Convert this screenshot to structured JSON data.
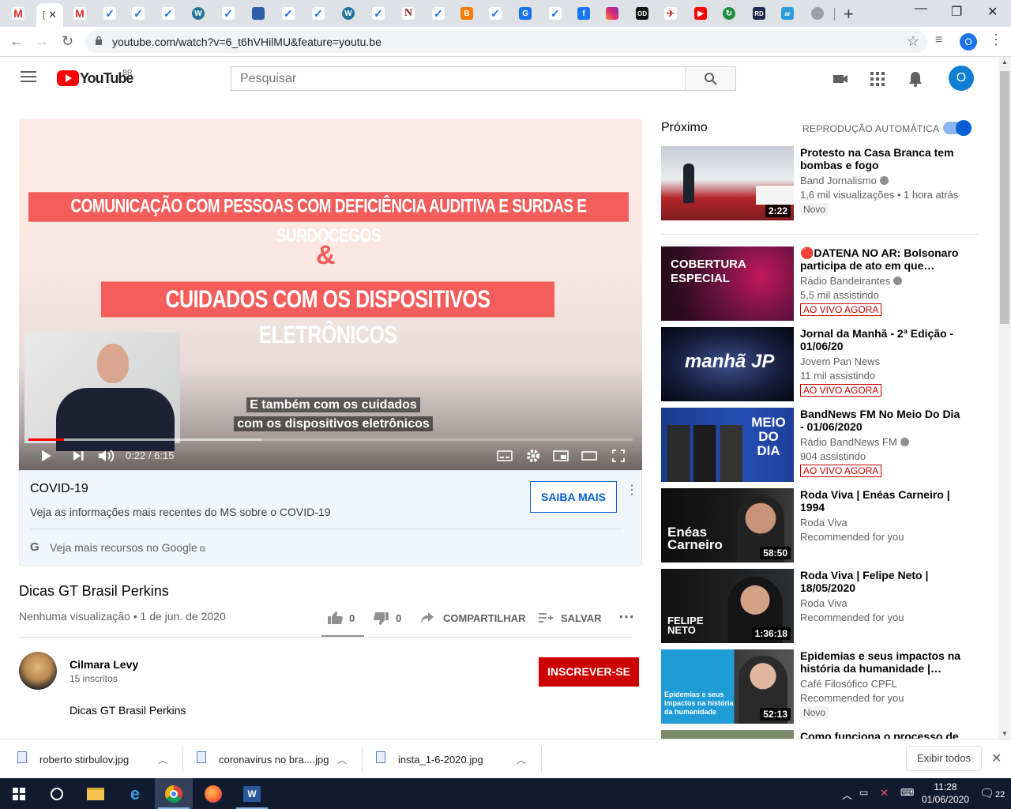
{
  "browser": {
    "active_tab_glyph": "[",
    "url": "youtube.com/watch?v=6_t6hVHilMU&feature=youtu.be",
    "profile_initial": "O"
  },
  "yt": {
    "logo_text": "YouTube",
    "country": "BR",
    "search_placeholder": "Pesquisar",
    "avatar_initial": "O"
  },
  "video": {
    "banner1": "COMUNICAÇÃO COM PESSOAS COM DEFICIÊNCIA AUDITIVA E SURDAS E SURDOCEGOS",
    "ampersand": "&",
    "banner2": "CUIDADOS COM OS DISPOSITIVOS ELETRÔNICOS",
    "caption_line1": "E também com os cuidados",
    "caption_line2": "com os dispositivos eletrônicos",
    "time": "0:22 / 6:15",
    "played_fraction": 0.059,
    "buffered_fraction": 0.385,
    "title": "Dicas GT Brasil Perkins",
    "meta": "Nenhuma visualização • 1 de jun. de 2020",
    "likes": "0",
    "dislikes": "0",
    "share_label": "COMPARTILHAR",
    "save_label": "SALVAR"
  },
  "covid": {
    "title": "COVID-19",
    "text": "Veja as informações mais recentes do MS sobre o COVID-19",
    "button": "SAIBA MAIS",
    "link": "Veja mais recursos no Google"
  },
  "channel": {
    "name": "Cilmara Levy",
    "subs": "15 inscritos",
    "subscribe": "INSCREVER-SE",
    "description": "Dicas GT Brasil Perkins"
  },
  "sidebar": {
    "next_label": "Próximo",
    "autoplay_label": "REPRODUÇÃO AUTOMÁTICA",
    "autoplay_on": true,
    "items": [
      {
        "title": "Protesto na Casa Branca tem bombas e fogo",
        "channel": "Band Jornalismo",
        "meta": "1,6 mil visualizações • 1 hora atrás",
        "badge": "Novo",
        "duration": "2:22"
      },
      {
        "title": "🔴DATENA NO AR: Bolsonaro participa de ato em que…",
        "channel": "Rádio Bandeirantes",
        "meta": "5,5 mil assistindo",
        "badge": "AO VIVO AGORA",
        "thumb_text": "COBERTURA ESPECIAL"
      },
      {
        "title": "Jornal da Manhã - 2ª Edição - 01/06/20",
        "channel": "Jovem Pan News",
        "meta": "11 mil assistindo",
        "badge": "AO VIVO AGORA",
        "thumb_text": "manhã JP"
      },
      {
        "title": "BandNews FM No Meio Do Dia - 01/06/2020",
        "channel": "Rádio BandNews FM",
        "meta": "904 assistindo",
        "badge": "AO VIVO AGORA",
        "thumb_text": "MEIO DO DIA"
      },
      {
        "title": "Roda Viva | Enéas Carneiro | 1994",
        "channel": "Roda Viva",
        "meta": "Recommended for you",
        "duration": "58:50",
        "thumb_text": "Enéas Carneiro"
      },
      {
        "title": "Roda Viva | Felipe Neto | 18/05/2020",
        "channel": "Roda Viva",
        "meta": "Recommended for you",
        "duration": "1:36:18",
        "thumb_text": "FELIPE NETO"
      },
      {
        "title": "Epidemias e seus impactos na história da humanidade |…",
        "channel": "Café Filosófico CPFL",
        "meta": "Recommended for you",
        "badge": "Novo",
        "duration": "52:13",
        "thumb_text": "Epidemias e seus impactos na história da humanidade"
      },
      {
        "title": "Como funciona o processo de"
      }
    ]
  },
  "downloads": {
    "items": [
      "roberto stirbulov.jpg",
      "coronavirus no bra....jpg",
      "insta_1-6-2020.jpg"
    ],
    "show_all": "Exibir todos"
  },
  "taskbar": {
    "time": "11:28",
    "date": "01/06/2020",
    "notifications": "22"
  },
  "colors": {
    "yt_red": "#ff0000",
    "subscribe": "#cc0000",
    "link_blue": "#065fd4",
    "banner": "#f35d5b"
  }
}
